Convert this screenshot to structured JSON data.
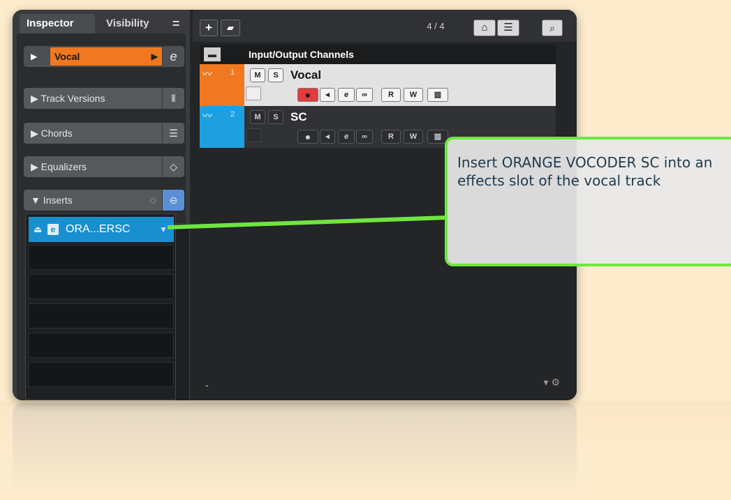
{
  "inspector": {
    "tabs": [
      {
        "label": "Inspector"
      },
      {
        "label": "Visibility"
      },
      {
        "label": "="
      }
    ],
    "track_name": "Vocal",
    "sections": [
      {
        "label": "Track Versions",
        "icon": "versions-icon"
      },
      {
        "label": "Chords",
        "icon": "chords-icon"
      },
      {
        "label": "Equalizers",
        "icon": "eq-icon"
      },
      {
        "label": "Inserts",
        "icon": "inserts-icon"
      }
    ],
    "insert_slot_1": "ORA...ERSC"
  },
  "tracks_area": {
    "toolbar": {
      "add": "+",
      "track_count": "4 / 4"
    },
    "io_folder_label": "Input/Output Channels",
    "tracks": [
      {
        "number": "1",
        "name": "Vocal",
        "color": "#f07820"
      },
      {
        "number": "2",
        "name": "SC",
        "color": "#1ea0e0"
      }
    ],
    "buttons": {
      "mute": "M",
      "solo": "S",
      "read": "R",
      "write": "W"
    }
  },
  "callout": {
    "text": "Insert ORANGE VOCODER SC into an effects slot of the vocal track",
    "border_color": "#6fe640"
  }
}
